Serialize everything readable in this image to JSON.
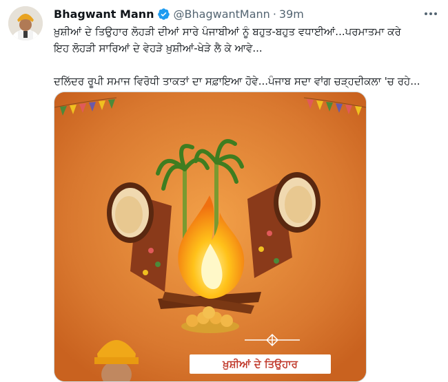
{
  "author": {
    "name": "Bhagwant Mann",
    "handle": "@BhagwantMann",
    "separator": "·",
    "time": "39m"
  },
  "tweet": {
    "lines": [
      "ਖ਼ੁਸ਼ੀਆਂ ਦੇ ਤਿਉਹਾਰ ਲੋਹੜੀ ਦੀਆਂ ਸਾਰੇ ਪੰਜਾਬੀਆਂ ਨੂੰ ਬਹੁਤ-ਬਹੁਤ ਵਧਾਈਆਂ...ਪਰਮਾਤਮਾ ਕਰੇ",
      "ਇਹ ਲੋਹੜੀ ਸਾਰਿਆਂ ਦੇ ਵੇਹੜੇ ਖ਼ੁਸ਼ੀਆਂ-ਖੇੜੇ ਲੈ ਕੇ ਆਵੇ...",
      "ਦਲਿੱਦਰ ਰੂਪੀ ਸਮਾਜ ਵਿਰੋਧੀ ਤਾਕਤਾਂ ਦਾ ਸਫ਼ਾਇਆ ਹੋਵੇ...ਪੰਜਾਬ ਸਦਾ ਵਾਂਗ ਚੜ੍ਹਦੀਕਲਾ 'ਚ ਰਹੇ..."
    ]
  },
  "media": {
    "banner_text": "ਖ਼ੁਸ਼ੀਆਂ ਦੇ ਤਿਉਹਾਰ",
    "background_color": "#d9782f"
  },
  "colors": {
    "verified": "#1d9bf0",
    "text": "#0f1419",
    "muted": "#536471"
  },
  "icons": {
    "verified": "verified-badge-icon",
    "more": "more-options-icon"
  }
}
